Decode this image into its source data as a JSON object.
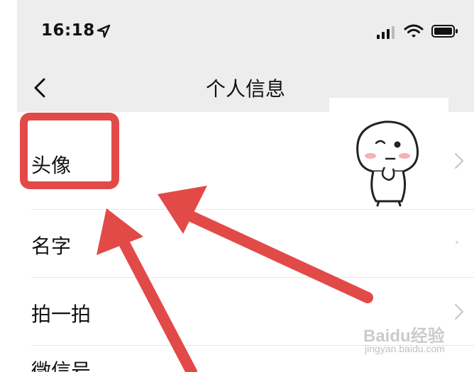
{
  "status_bar": {
    "time": "16:18",
    "icons": [
      "location-arrow-icon",
      "signal-icon",
      "wifi-icon",
      "battery-icon"
    ]
  },
  "nav": {
    "back_icon": "chevron-left-icon",
    "title": "个人信息"
  },
  "rows": [
    {
      "label": "头像",
      "icon": "chevron-right-icon"
    },
    {
      "label": "名字"
    },
    {
      "label": "拍一拍",
      "icon": "chevron-right-icon"
    },
    {
      "label": "微信号"
    }
  ],
  "annotations": {
    "highlight_color": "#e24a48",
    "arrow_color": "#e24a48"
  },
  "watermark": {
    "brand": "Baidu经验",
    "url": "jingyan.baidu.com"
  },
  "colors": {
    "header_bg": "#ededed",
    "list_bg": "#ffffff",
    "divider": "#e6e6e6"
  }
}
